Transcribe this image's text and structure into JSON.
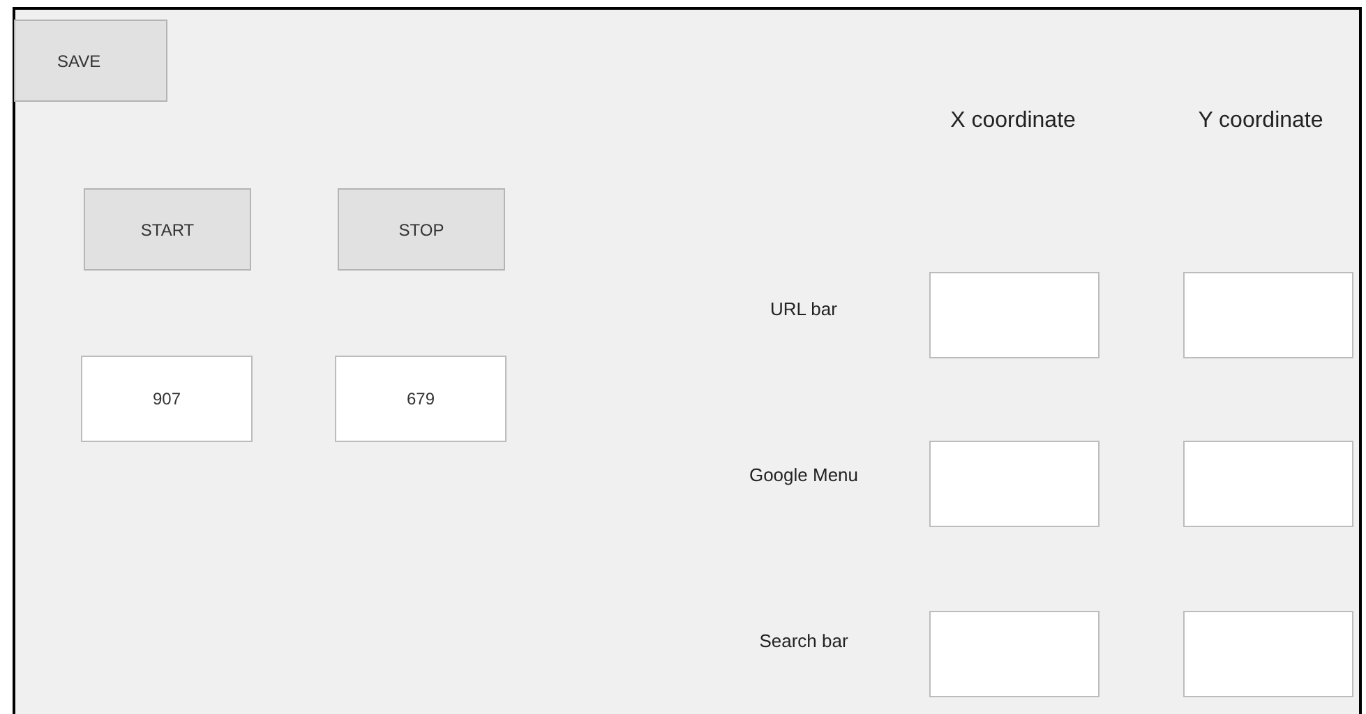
{
  "buttons": [
    {
      "label": "SAVE"
    },
    {
      "label": "START"
    },
    {
      "label": "STOP"
    }
  ],
  "readouts": [
    {
      "value": "907"
    },
    {
      "value": "679"
    }
  ],
  "columns": [
    "X coordinate",
    "Y coordinate"
  ],
  "rows": [
    {
      "label": "URL bar"
    },
    {
      "label": "Google Menu"
    },
    {
      "label": "Search bar"
    }
  ]
}
